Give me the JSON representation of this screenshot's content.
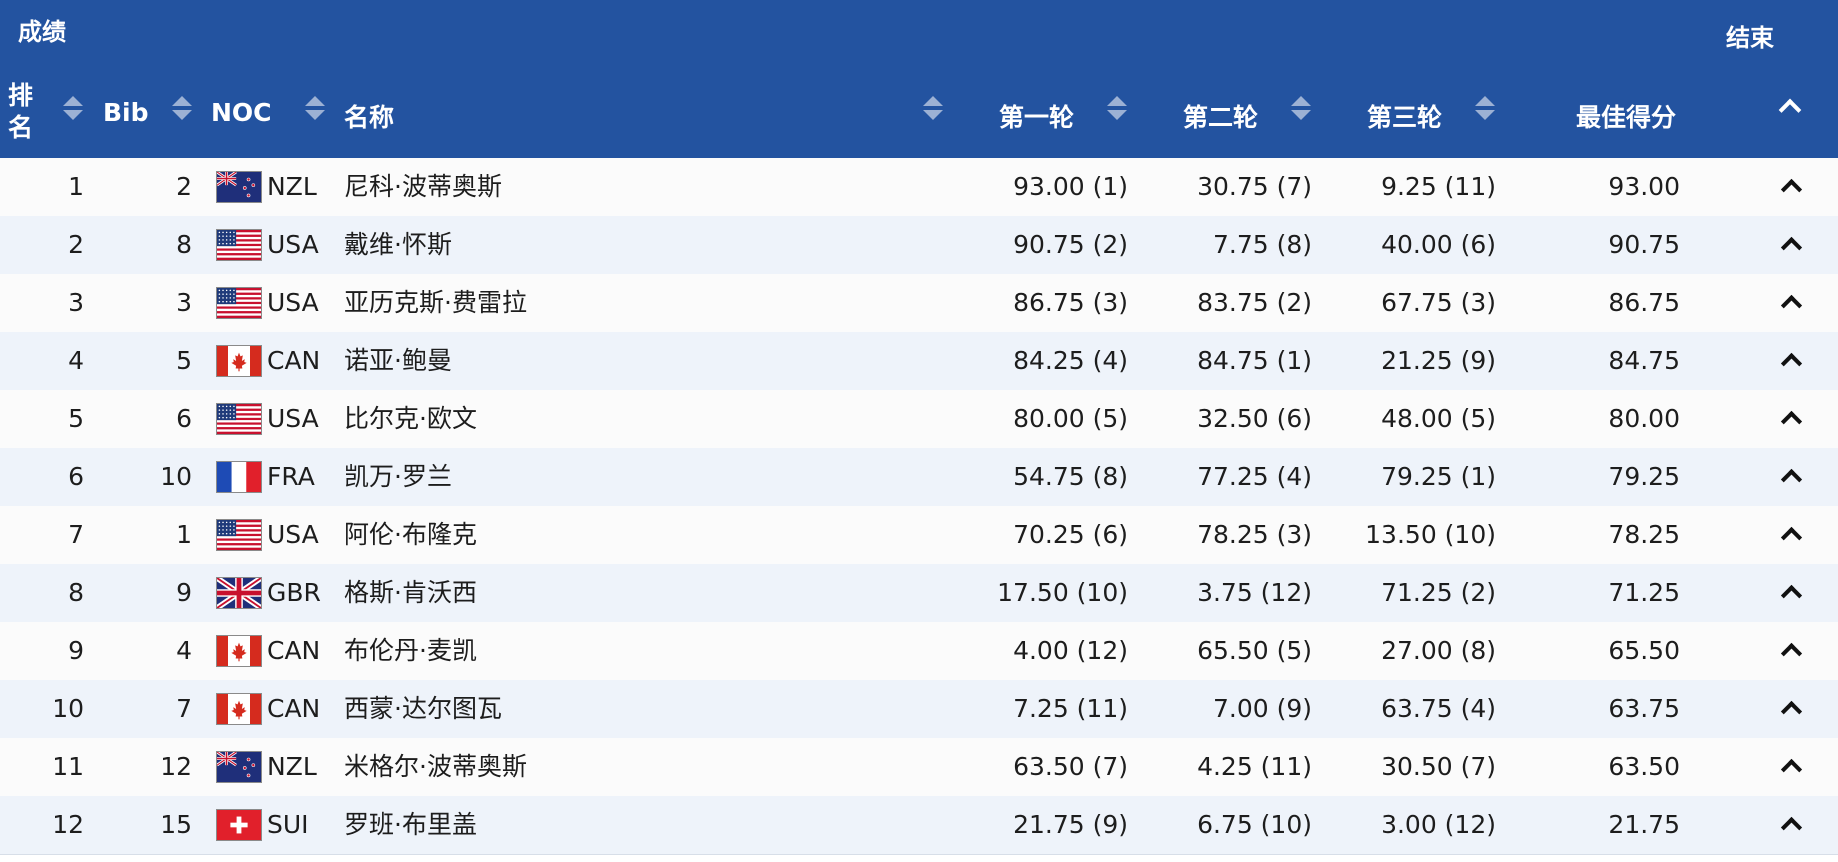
{
  "header": {
    "title": "成绩",
    "status": "结束",
    "columns": {
      "rank": "排名",
      "bib": "Bib",
      "noc": "NOC",
      "name": "名称",
      "run1": "第一轮",
      "run2": "第二轮",
      "run3": "第三轮",
      "best": "最佳得分"
    }
  },
  "rows": [
    {
      "rank": "1",
      "bib": "2",
      "noc": "NZL",
      "flag": "nzl-flag",
      "name": "尼科·波蒂奥斯",
      "run1": "93.00 (1)",
      "run2": "30.75 (7)",
      "run3": "9.25 (11)",
      "best": "93.00"
    },
    {
      "rank": "2",
      "bib": "8",
      "noc": "USA",
      "flag": "usa-flag",
      "name": "戴维·怀斯",
      "run1": "90.75 (2)",
      "run2": "7.75 (8)",
      "run3": "40.00 (6)",
      "best": "90.75"
    },
    {
      "rank": "3",
      "bib": "3",
      "noc": "USA",
      "flag": "usa-flag",
      "name": "亚历克斯·费雷拉",
      "run1": "86.75 (3)",
      "run2": "83.75 (2)",
      "run3": "67.75 (3)",
      "best": "86.75"
    },
    {
      "rank": "4",
      "bib": "5",
      "noc": "CAN",
      "flag": "can-flag",
      "name": "诺亚·鲍曼",
      "run1": "84.25 (4)",
      "run2": "84.75 (1)",
      "run3": "21.25 (9)",
      "best": "84.75"
    },
    {
      "rank": "5",
      "bib": "6",
      "noc": "USA",
      "flag": "usa-flag",
      "name": "比尔克·欧文",
      "run1": "80.00 (5)",
      "run2": "32.50 (6)",
      "run3": "48.00 (5)",
      "best": "80.00"
    },
    {
      "rank": "6",
      "bib": "10",
      "noc": "FRA",
      "flag": "fra-flag",
      "name": "凯万·罗兰",
      "run1": "54.75 (8)",
      "run2": "77.25 (4)",
      "run3": "79.25 (1)",
      "best": "79.25"
    },
    {
      "rank": "7",
      "bib": "1",
      "noc": "USA",
      "flag": "usa-flag",
      "name": "阿伦·布隆克",
      "run1": "70.25 (6)",
      "run2": "78.25 (3)",
      "run3": "13.50 (10)",
      "best": "78.25"
    },
    {
      "rank": "8",
      "bib": "9",
      "noc": "GBR",
      "flag": "gbr-flag",
      "name": "格斯·肯沃西",
      "run1": "17.50 (10)",
      "run2": "3.75 (12)",
      "run3": "71.25 (2)",
      "best": "71.25"
    },
    {
      "rank": "9",
      "bib": "4",
      "noc": "CAN",
      "flag": "can-flag",
      "name": "布伦丹·麦凯",
      "run1": "4.00 (12)",
      "run2": "65.50 (5)",
      "run3": "27.00 (8)",
      "best": "65.50"
    },
    {
      "rank": "10",
      "bib": "7",
      "noc": "CAN",
      "flag": "can-flag",
      "name": "西蒙·达尔图瓦",
      "run1": "7.25 (11)",
      "run2": "7.00 (9)",
      "run3": "63.75 (4)",
      "best": "63.75"
    },
    {
      "rank": "11",
      "bib": "12",
      "noc": "NZL",
      "flag": "nzl-flag",
      "name": "米格尔·波蒂奥斯",
      "run1": "63.50 (7)",
      "run2": "4.25 (11)",
      "run3": "30.50 (7)",
      "best": "63.50"
    },
    {
      "rank": "12",
      "bib": "15",
      "noc": "SUI",
      "flag": "sui-flag",
      "name": "罗班·布里盖",
      "run1": "21.75 (9)",
      "run2": "6.75 (10)",
      "run3": "3.00 (12)",
      "best": "21.75"
    }
  ],
  "colors": {
    "header_bg": "#2353a0",
    "row_even": "#eef3fa",
    "row_odd": "#fbfbfb"
  }
}
